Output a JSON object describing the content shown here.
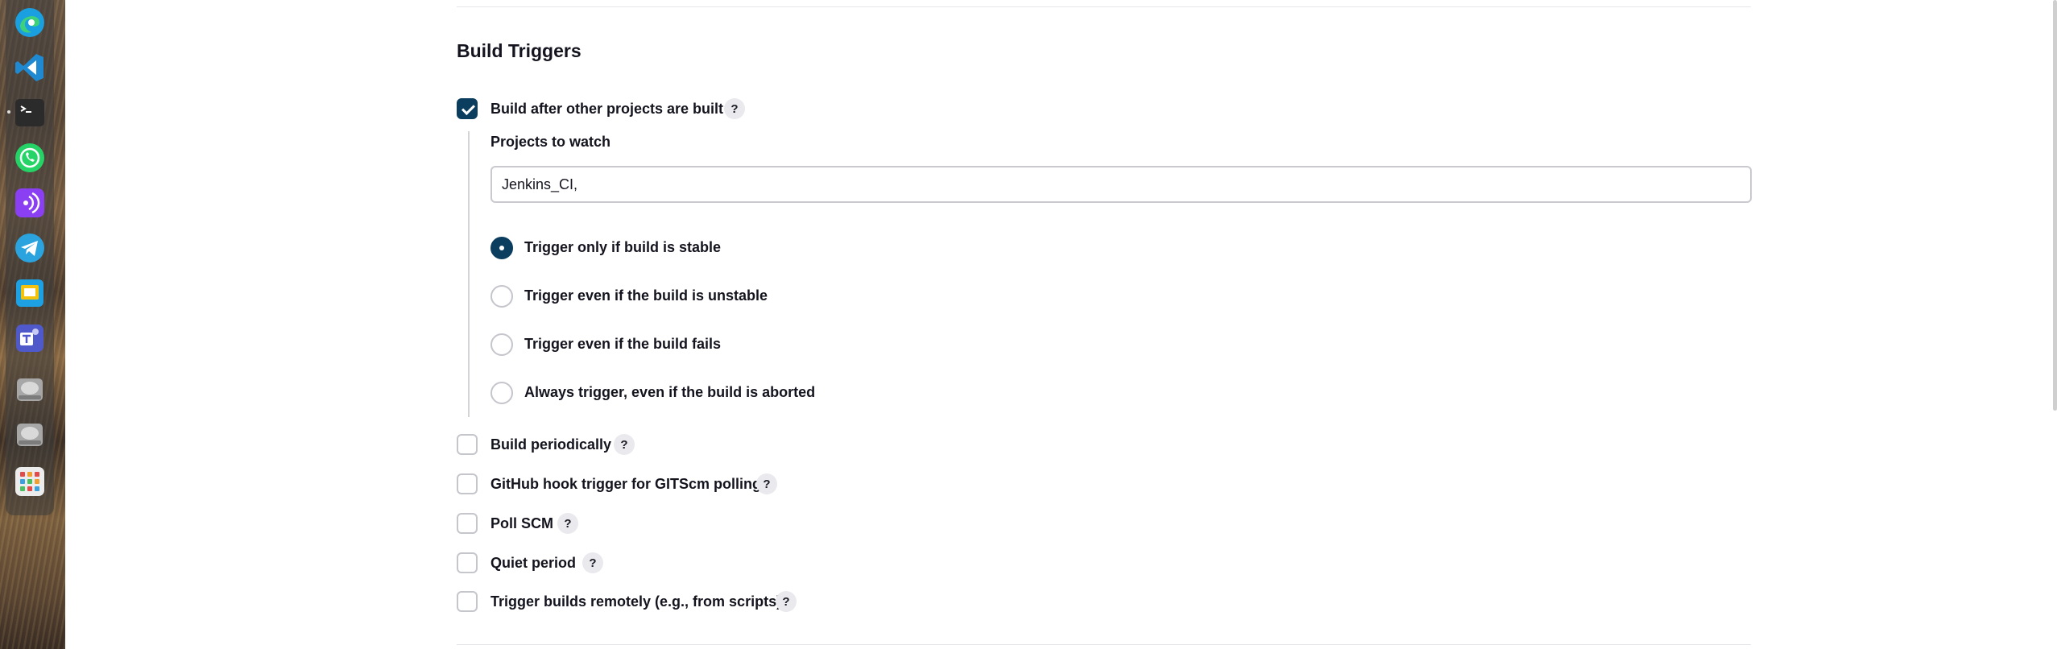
{
  "dock": {
    "apps": [
      {
        "name": "edge-icon",
        "color": "#1aa0e0"
      },
      {
        "name": "vscode-icon",
        "color": "#1f8ad2"
      },
      {
        "name": "terminal-icon",
        "color": "#2b2b2b"
      },
      {
        "name": "whatsapp-icon",
        "color": "#25d366"
      },
      {
        "name": "podcast-icon",
        "color": "#8a3ff2"
      },
      {
        "name": "telegram-icon",
        "color": "#2aa3df"
      },
      {
        "name": "slides-icon",
        "color": "#1da1e2"
      },
      {
        "name": "teams-icon",
        "color": "#5059c9"
      },
      {
        "name": "drive-icon",
        "color": "#9a9a9a"
      },
      {
        "name": "drive-icon-2",
        "color": "#9a9a9a"
      },
      {
        "name": "app-grid-icon",
        "color": "#e9e9e9"
      }
    ]
  },
  "section": {
    "title": "Build Triggers"
  },
  "triggers": {
    "after_other": {
      "label": "Build after other projects are built",
      "checked": true,
      "help": "?",
      "projects_label": "Projects to watch",
      "projects_value": "Jenkins_CI,",
      "options": [
        {
          "label": "Trigger only if build is stable",
          "selected": true
        },
        {
          "label": "Trigger even if the build is unstable",
          "selected": false
        },
        {
          "label": "Trigger even if the build fails",
          "selected": false
        },
        {
          "label": "Always trigger, even if the build is aborted",
          "selected": false
        }
      ]
    },
    "others": [
      {
        "label": "Build periodically",
        "help": "?"
      },
      {
        "label": "GitHub hook trigger for GITScm polling",
        "help": "?"
      },
      {
        "label": "Poll SCM",
        "help": "?"
      },
      {
        "label": "Quiet period",
        "help": "?"
      },
      {
        "label": "Trigger builds remotely (e.g., from scripts)",
        "help": "?"
      }
    ]
  },
  "colors": {
    "accent": "#0b3d5f",
    "border": "#c5c6cc",
    "help_bg": "#e9e9ee"
  }
}
